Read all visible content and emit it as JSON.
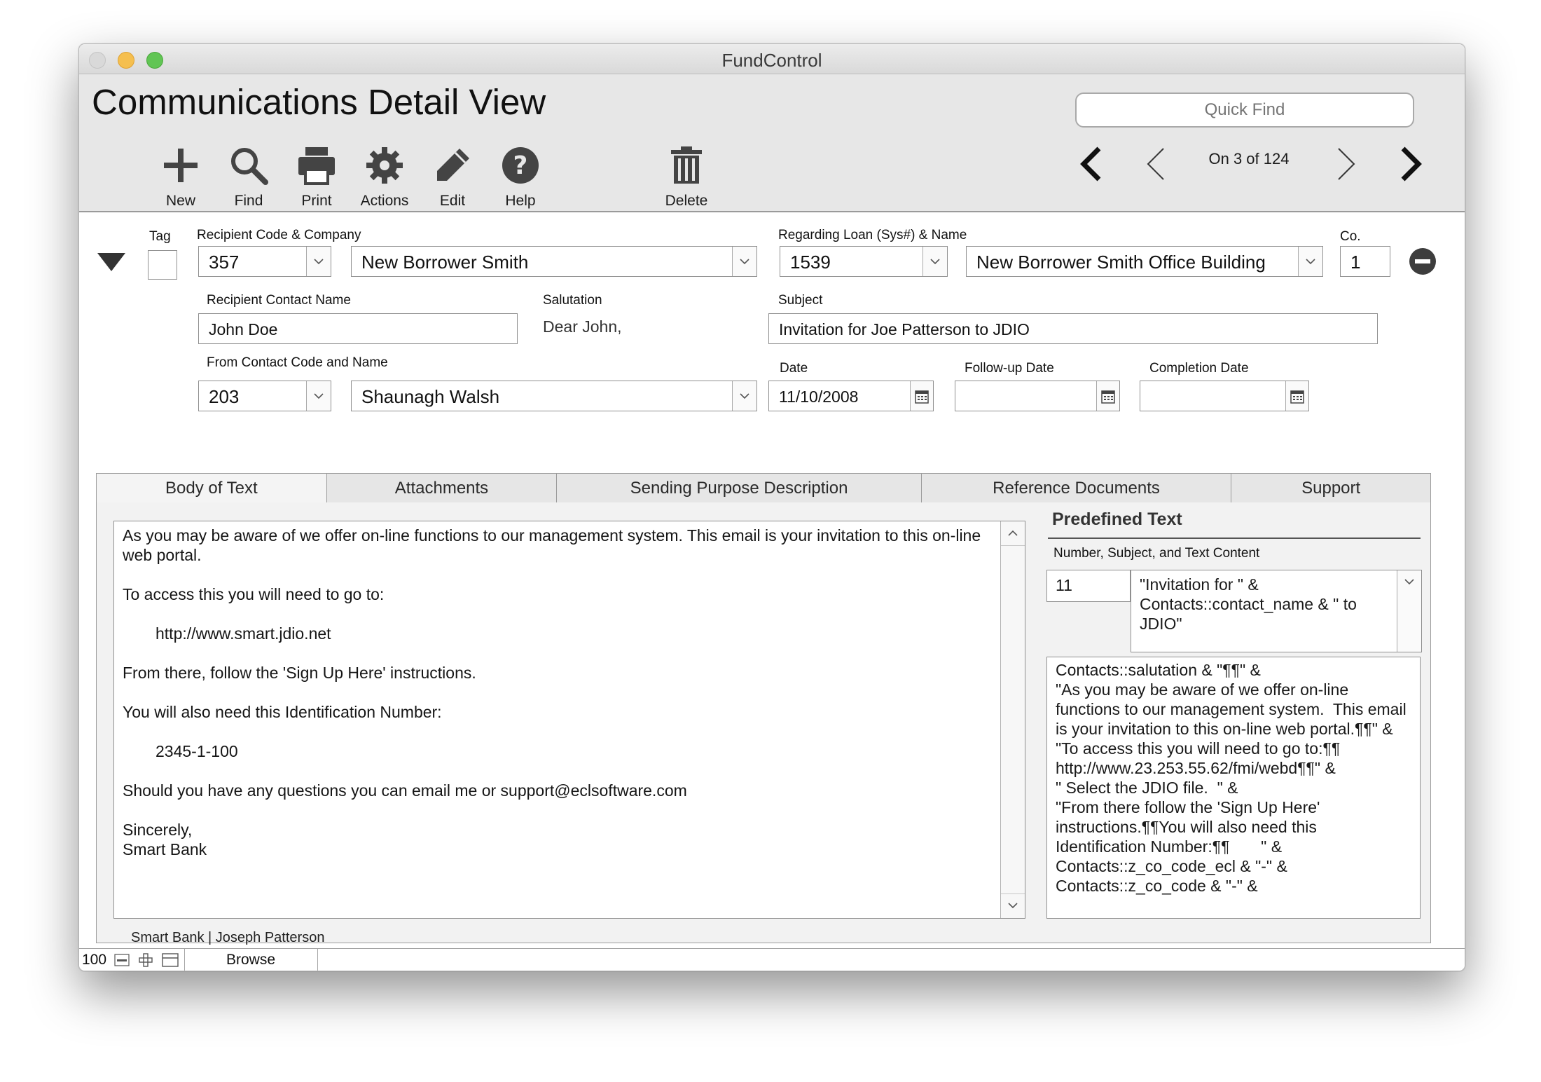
{
  "window": {
    "title": "FundControl"
  },
  "header": {
    "page_title": "Communications Detail View",
    "quick_find_placeholder": "Quick Find",
    "toolbar": {
      "new": "New",
      "find": "Find",
      "print": "Print",
      "actions": "Actions",
      "edit": "Edit",
      "help": "Help",
      "delete": "Delete"
    },
    "record_nav": {
      "status": "On 3 of 124"
    }
  },
  "form": {
    "tag_label": "Tag",
    "recipient_label": "Recipient Code & Company",
    "recipient_code": "357",
    "recipient_company": "New Borrower Smith",
    "loan_label": "Regarding Loan (Sys#) & Name",
    "loan_sys": "1539",
    "loan_name": "New Borrower Smith Office Building",
    "co_label": "Co.",
    "co_value": "1",
    "contact_name_label": "Recipient Contact Name",
    "contact_name": "John Doe",
    "salutation_label": "Salutation",
    "salutation": "Dear John,",
    "subject_label": "Subject",
    "subject": "Invitation for Joe Patterson to JDIO",
    "from_label": "From Contact Code and Name",
    "from_code": "203",
    "from_name": "Shaunagh Walsh",
    "date_label": "Date",
    "date": "11/10/2008",
    "followup_label": "Follow-up Date",
    "followup": "",
    "completion_label": "Completion Date",
    "completion": ""
  },
  "tabs": [
    "Body of Text",
    "Attachments",
    "Sending Purpose Description",
    "Reference Documents",
    "Support"
  ],
  "body_text": {
    "p1": "As you may be aware of we offer on-line functions to our management system.  This email is your invitation to this on-line web portal.",
    "p2": "To access this you will need to go to:",
    "p3": "http://www.smart.jdio.net",
    "p4": "From there, follow the 'Sign Up Here' instructions.",
    "p5": "You will also need this Identification Number:",
    "p6": "2345-1-100",
    "p7": "Should you have any questions you can email me or support@eclsoftware.com",
    "p8a": "Sincerely,",
    "p8b": "Smart Bank"
  },
  "predefined": {
    "title": "Predefined Text",
    "subtitle": "Number, Subject, and Text Content",
    "number": "11",
    "subject": "\"Invitation for \" & Contacts::contact_name &  \" to JDIO\"",
    "content": "Contacts::salutation & \"¶¶\" &\n\"As you may be aware of we offer on-line functions to our management system.  This email is your invitation to this on-line web portal.¶¶\" &\n\"To access this you will need to go to:¶¶ http://www.23.253.55.62/fmi/webd¶¶\" &\n\" Select the JDIO file.  \" &\n\"From there follow the 'Sign Up Here' instructions.¶¶You will also need this Identification Number:¶¶       \" &\nContacts::z_co_code_ecl & \"-\" &\nContacts::z_co_code & \"-\" &"
  },
  "footer": {
    "text": "Smart Bank | Joseph Patterson"
  },
  "statusbar": {
    "zoom": "100",
    "mode": "Browse"
  }
}
